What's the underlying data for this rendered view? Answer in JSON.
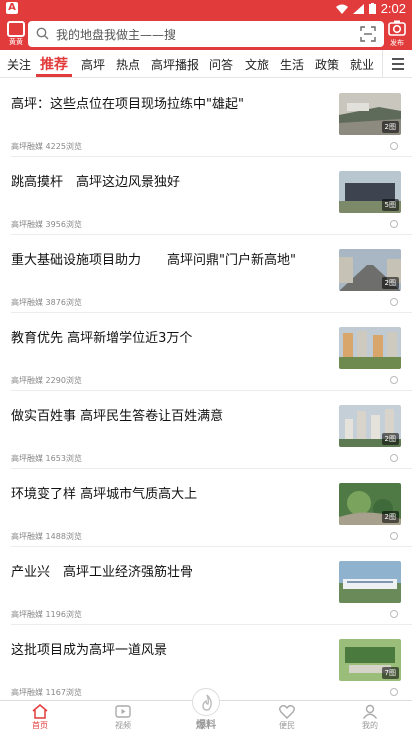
{
  "status_bar": {
    "time": "2:02",
    "left_icon": "app-notification-icon"
  },
  "header": {
    "logo_label": "黄黄",
    "search_placeholder": "我的地盘我做主——搜",
    "publish_label": "发布"
  },
  "tabs": [
    "关注",
    "推荐",
    "高坪",
    "热点",
    "高坪播报",
    "问答",
    "文旅",
    "生活",
    "政策",
    "就业"
  ],
  "active_tab": "推荐",
  "feed": [
    {
      "title": "高坪：这些点位在项目现场拉练中\"雄起\"",
      "source": "高坪融媒",
      "views": "4225浏览",
      "img_count": "2图"
    },
    {
      "title": "跳高摸杆　高坪这边风景独好",
      "source": "高坪融媒",
      "views": "3956浏览",
      "img_count": "5图"
    },
    {
      "title": "重大基础设施项目助力　　高坪问鼎\"门户新高地\"",
      "source": "高坪融媒",
      "views": "3876浏览",
      "img_count": "2图"
    },
    {
      "title": "教育优先 高坪新增学位近3万个",
      "source": "高坪融媒",
      "views": "2290浏览",
      "img_count": ""
    },
    {
      "title": "做实百姓事 高坪民生答卷让百姓满意",
      "source": "高坪融媒",
      "views": "1653浏览",
      "img_count": "2图"
    },
    {
      "title": "环境变了样 高坪城市气质高大上",
      "source": "高坪融媒",
      "views": "1488浏览",
      "img_count": "2图"
    },
    {
      "title": "产业兴　高坪工业经济强筋壮骨",
      "source": "高坪融媒",
      "views": "1196浏览",
      "img_count": ""
    },
    {
      "title": "这批项目成为高坪一道风景",
      "source": "高坪融媒",
      "views": "1167浏览",
      "img_count": "7图"
    }
  ],
  "bottom_nav": [
    {
      "label": "首页",
      "icon": "home-icon",
      "active": true
    },
    {
      "label": "视频",
      "icon": "video-icon",
      "active": false
    },
    {
      "label": "爆料",
      "icon": "fire-icon",
      "active": false
    },
    {
      "label": "便民",
      "icon": "heart-icon",
      "active": false
    },
    {
      "label": "我的",
      "icon": "user-icon",
      "active": false
    }
  ],
  "colors": {
    "brand": "#e23b3b",
    "text": "#111111",
    "meta": "#888888"
  }
}
